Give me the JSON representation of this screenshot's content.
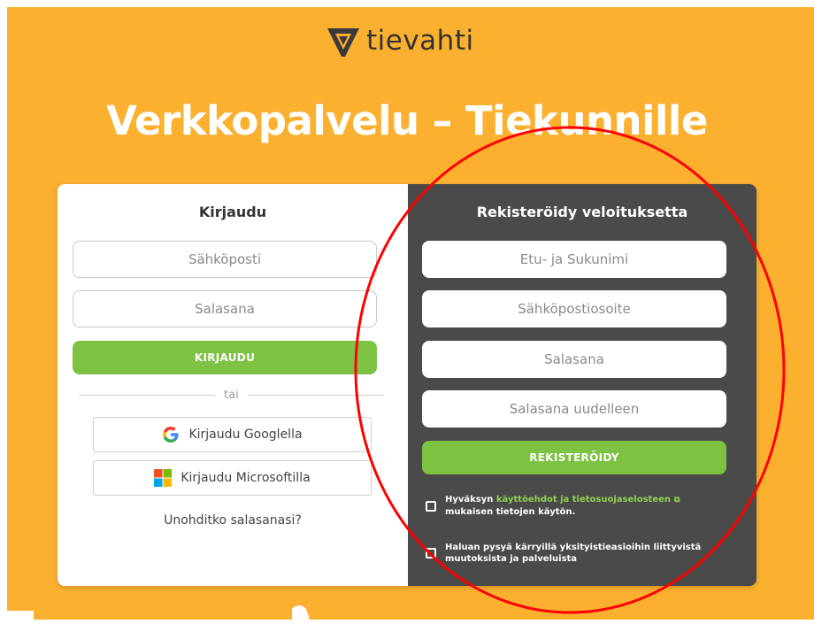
{
  "brand": {
    "name": "tievahti",
    "color": "#fbb030"
  },
  "headline": "Verkkopalvelu – Tiekunnille",
  "login": {
    "title": "Kirjaudu",
    "email_placeholder": "Sähköposti",
    "password_placeholder": "Salasana",
    "submit_label": "KIRJAUDU",
    "divider_text": "tai",
    "google_label": "Kirjaudu Googlella",
    "microsoft_label": "Kirjaudu Microsoftilla",
    "forgot_label": "Unohditko salasanasi?"
  },
  "register": {
    "title": "Rekisteröidy veloituksetta",
    "name_placeholder": "Etu- ja Sukunimi",
    "email_placeholder": "Sähköpostiosoite",
    "password_placeholder": "Salasana",
    "password_repeat_placeholder": "Salasana uudelleen",
    "submit_label": "REKISTERÖIDY",
    "terms": {
      "prefix": "Hyväksyn",
      "link": "käyttöehdot ja tietosuojaselosteen",
      "suffix": "mukaisen tietojen käytön."
    },
    "newsletter": "Haluan pysyä kärryillä yksityistieasioihin liittyvistä muutoksista ja palveluista"
  },
  "colors": {
    "accent_green": "#7dc243",
    "panel_dark": "#4a4a4a",
    "annotation_red": "#ff0000"
  },
  "icons": {
    "logo": "tievahti-v-logo-icon",
    "google": "google-icon",
    "microsoft": "microsoft-icon",
    "external": "external-link-icon"
  }
}
